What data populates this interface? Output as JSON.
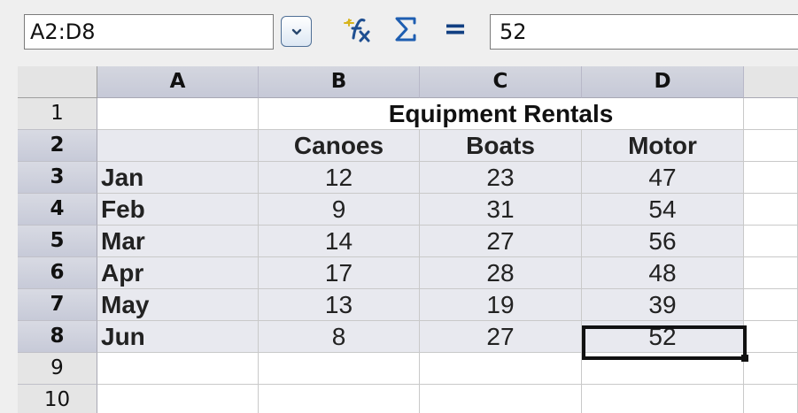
{
  "formula_bar": {
    "name_box_value": "A2:D8",
    "formula_value": "52",
    "equals_label": "="
  },
  "sheet": {
    "column_headers": [
      "A",
      "B",
      "C",
      "D"
    ],
    "row_numbers": [
      "1",
      "2",
      "3",
      "4",
      "5",
      "6",
      "7",
      "8",
      "9",
      "10"
    ],
    "title": "Equipment Rentals",
    "headers": [
      "Canoes",
      "Boats",
      "Motor"
    ],
    "rows": [
      {
        "month": "Jan",
        "canoes": "12",
        "boats": "23",
        "motor": "47"
      },
      {
        "month": "Feb",
        "canoes": "9",
        "boats": "31",
        "motor": "54"
      },
      {
        "month": "Mar",
        "canoes": "14",
        "boats": "27",
        "motor": "56"
      },
      {
        "month": "Apr",
        "canoes": "17",
        "boats": "28",
        "motor": "48"
      },
      {
        "month": "May",
        "canoes": "13",
        "boats": "19",
        "motor": "39"
      },
      {
        "month": "Jun",
        "canoes": "8",
        "boats": "27",
        "motor": "52"
      }
    ]
  },
  "icons": {
    "dropdown": "chevron-down-icon",
    "function_wizard": "function-wizard-icon",
    "sum": "sum-icon"
  },
  "colors": {
    "header_selected": "#c9ccd9",
    "active_border": "#111111",
    "accent": "#113f82"
  }
}
